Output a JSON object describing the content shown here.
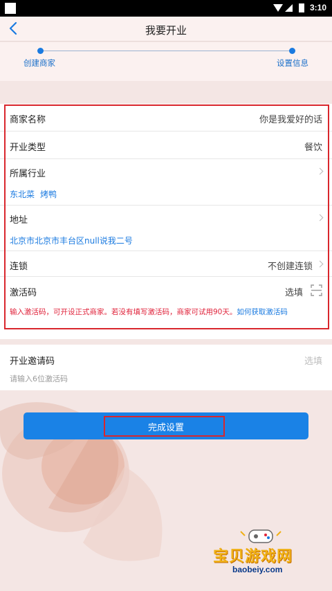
{
  "status_bar": {
    "time": "3:10"
  },
  "header": {
    "title": "我要开业",
    "back_icon": "chevron-left-icon"
  },
  "steps": [
    {
      "label": "创建商家"
    },
    {
      "label": "设置信息"
    }
  ],
  "form": {
    "merchant_name": {
      "label": "商家名称",
      "value": "你是我爱好的话"
    },
    "business_type": {
      "label": "开业类型",
      "value": "餐饮"
    },
    "industry": {
      "label": "所属行业",
      "tags": [
        "东北菜",
        "烤鸭"
      ]
    },
    "address": {
      "label": "地址",
      "value": "北京市北京市丰台区null说我二号"
    },
    "chain": {
      "label": "连锁",
      "value": "不创建连锁"
    },
    "activation_code": {
      "label": "激活码",
      "placeholder": "选填",
      "warning": "输入激活码，可开设正式商家。若没有填写激活码，商家可试用90天。",
      "help_link": "如何获取激活码"
    }
  },
  "invite": {
    "label": "开业邀请码",
    "placeholder": "选填",
    "hint": "请输入6位激活码"
  },
  "submit": {
    "label": "完成设置"
  },
  "watermark": {
    "brand": "宝贝游戏网",
    "url": "baobeiy.com"
  },
  "colors": {
    "accent": "#1a82e6",
    "warning": "#e0233b",
    "highlight_box": "#d9262c"
  }
}
